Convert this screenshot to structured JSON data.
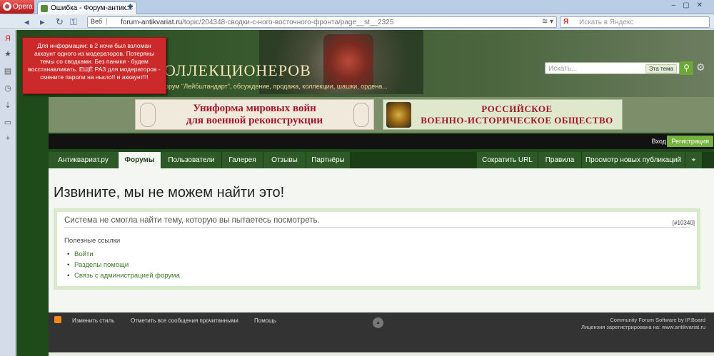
{
  "browser": {
    "app_name": "Opera",
    "tab_title": "Ошибка - Форум-антик...",
    "url_prefix": "Веб",
    "url_host": "forum-antikvariat.ru",
    "url_path": "/topic/204348-сводки-с-ного-восточного-фронта/page__st__2325",
    "search_placeholder": "Искать в Яндекс"
  },
  "alert": {
    "text": "Для информации: в 2 ночи был взломан аккаунт одного из модераторов. Потеряны темы со сводками. Без паники - будем восстанавливать. ЕЩЁ РАЗ для модераторов - смените пароли на нькло!! и аккаунт!!!"
  },
  "header": {
    "site_title": "ОЛЛЕКЦИОНЕРОВ",
    "site_subtitle": "орум \"Лейбштандарт\", обсуждение, продажа, коллекции, шашки, ордена...",
    "search_placeholder": "Искать...",
    "search_scope": "Эта тема"
  },
  "banners": {
    "left_line1": "Униформа мировых войн",
    "left_line2": "для военной реконструкции",
    "right_line1": "РОССИЙСКОЕ",
    "right_line2": "ВОЕННО-ИСТОРИЧЕСКОЕ ОБЩЕСТВО"
  },
  "userbar": {
    "login": "Вход",
    "register": "Регистрация"
  },
  "nav": {
    "left": [
      "Антиквариат.ру",
      "Форумы",
      "Пользователи",
      "Галерея",
      "Отзывы",
      "Партнёры"
    ],
    "right": [
      "Сократить URL",
      "Правила",
      "Просмотр новых публикаций"
    ],
    "active": "Форумы"
  },
  "content": {
    "title": "Извините, мы не можем найти это!",
    "message": "Система не смогла найти тему, которую вы пытаетесь посмотреть.",
    "error_code": "[#10340]",
    "useful_links_title": "Полезные ссылки",
    "links": [
      "Войти",
      "Разделы помощи",
      "Связь с администрацией форума"
    ]
  },
  "footer": {
    "links": [
      "Изменить стиль",
      "Отметить все сообщения прочитанными",
      "Помощь"
    ],
    "powered_line1": "Community Forum Software by IP.Board",
    "powered_line2": "Лицензия зарегистрирована на: www.antikvariat.ru"
  }
}
